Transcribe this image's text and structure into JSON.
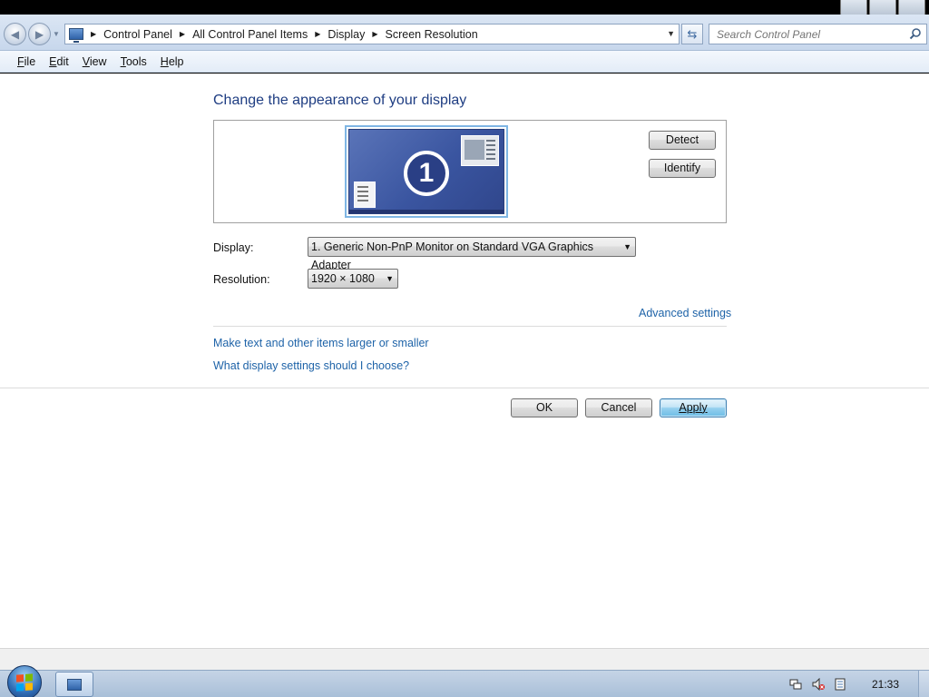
{
  "window": {
    "breadcrumbs": [
      "Control Panel",
      "All Control Panel Items",
      "Display",
      "Screen Resolution"
    ],
    "search": {
      "placeholder": "Search Control Panel"
    }
  },
  "menu": [
    "File",
    "Edit",
    "View",
    "Tools",
    "Help"
  ],
  "main": {
    "heading": "Change the appearance of your display",
    "monitor_number": "1",
    "detect_label": "Detect",
    "identify_label": "Identify",
    "display_label": "Display:",
    "display_value": "1. Generic Non-PnP Monitor on Standard VGA Graphics Adapter",
    "resolution_label": "Resolution:",
    "resolution_value": "1920 × 1080",
    "advanced_link": "Advanced settings",
    "text_size_link": "Make text and other items larger or smaller",
    "help_link": "What display settings should I choose?",
    "ok_label": "OK",
    "cancel_label": "Cancel",
    "apply_label": "Apply"
  },
  "taskbar": {
    "clock": "21:33",
    "items": [
      "control-panel-icon"
    ],
    "tray_icons": [
      "network-icon",
      "volume-muted-icon",
      "action-center-icon"
    ]
  },
  "colors": {
    "heading": "#1e3d82",
    "link": "#1e63a8",
    "monitor_fill": "#3a55a0"
  }
}
